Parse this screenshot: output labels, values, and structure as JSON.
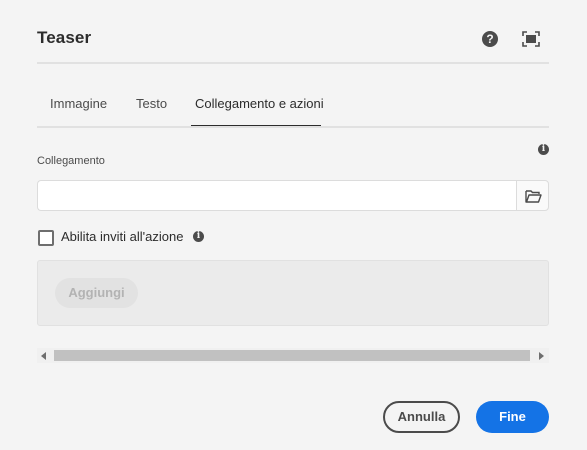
{
  "dialog": {
    "title": "Teaser",
    "help_glyph": "?",
    "icons": [
      "help-icon",
      "fullscreen-icon"
    ]
  },
  "tabs": [
    {
      "label": "Immagine",
      "active": false
    },
    {
      "label": "Testo",
      "active": false
    },
    {
      "label": "Collegamento e azioni",
      "active": true
    }
  ],
  "link_field": {
    "label": "Collegamento",
    "value": "",
    "placeholder": "",
    "info_glyph": "i",
    "browse_icon": "folder-open-icon"
  },
  "cta": {
    "checkbox_label": "Abilita inviti all'azione",
    "checked": false,
    "info_glyph": "i",
    "add_label": "Aggiungi"
  },
  "footer": {
    "cancel_label": "Annulla",
    "done_label": "Fine"
  },
  "colors": {
    "accent": "#1473e6",
    "background": "#f4f4f4",
    "text": "#2c2c2c"
  }
}
